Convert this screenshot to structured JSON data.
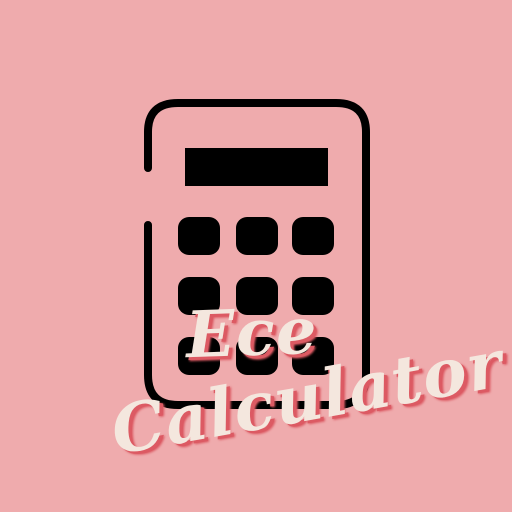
{
  "logo": {
    "line1": "Ece",
    "line2": "Calculator"
  },
  "icon": "calculator-icon",
  "colors": {
    "background": "#EFABAD",
    "icon": "#000000",
    "logo_text": "#F4E7DE",
    "logo_shadow": "#DC5A63"
  }
}
